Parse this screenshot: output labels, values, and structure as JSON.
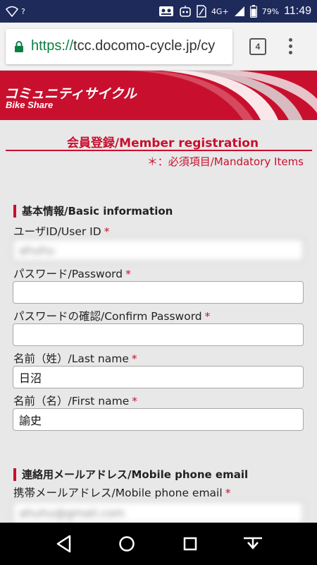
{
  "status_bar": {
    "network": "4G+",
    "battery": "79%",
    "time": "11:49",
    "unknown_badge": "?"
  },
  "browser": {
    "url_scheme": "https://",
    "url_host": "tcc.docomo-cycle.jp/cy",
    "tab_count": "4"
  },
  "banner": {
    "title": "コミュニティサイクル",
    "subtitle": "Bike Share",
    "color": "#c8102e"
  },
  "page": {
    "title": "会員登録/Member registration",
    "mandatory_note": "＊：必須項目/Mandatory Items"
  },
  "sections": {
    "basic": "基本情報/Basic information",
    "email": "連絡用メールアドレス/Mobile phone email"
  },
  "fields": {
    "user_id": {
      "label": "ユーザID/User ID",
      "value": "ahuhu"
    },
    "password": {
      "label": "パスワード/Password",
      "value": ""
    },
    "confirm_password": {
      "label": "パスワードの確認/Confirm Password",
      "value": ""
    },
    "last_name": {
      "label": "名前（姓）/Last name",
      "value": "日沼"
    },
    "first_name": {
      "label": "名前（名）/First name",
      "value": "諭史"
    },
    "mobile_email": {
      "label": "携帯メールアドレス/Mobile phone email",
      "value": "ahuhu@gmail.com"
    }
  },
  "required_mark": "*"
}
